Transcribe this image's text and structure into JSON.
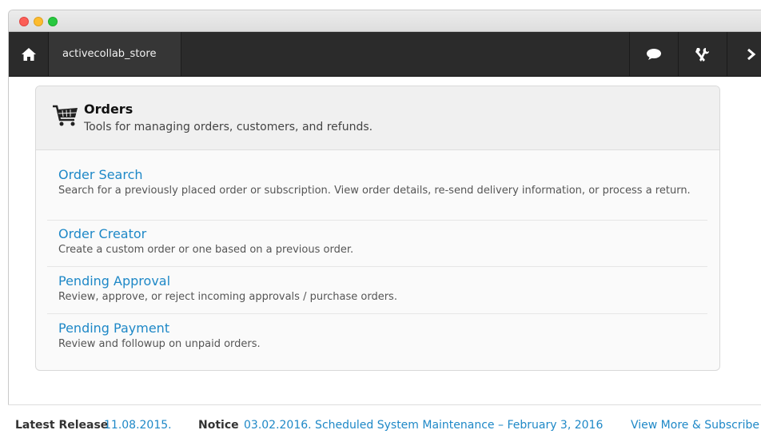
{
  "navbar": {
    "store_name": "activecollab_store"
  },
  "panel": {
    "title": "Orders",
    "subtitle": "Tools for managing orders, customers, and refunds.",
    "items": [
      {
        "title": "Order Search",
        "description": "Search for a previously placed order or subscription. View order details, re-send delivery information, or process a return."
      },
      {
        "title": "Order Creator",
        "description": "Create a custom order or one based on a previous order."
      },
      {
        "title": "Pending Approval",
        "description": "Review, approve, or reject incoming approvals / purchase orders."
      },
      {
        "title": "Pending Payment",
        "description": "Review and followup on unpaid orders."
      }
    ]
  },
  "footer": {
    "release_label": "Latest Release",
    "release_value": "11.08.2015.",
    "notice_label": "Notice",
    "notice_value": "03.02.2016. Scheduled System Maintenance – February 3, 2016",
    "view_more": "View More & Subscribe"
  },
  "icons": {
    "home": "home-icon",
    "chat": "chat-bubble-icon",
    "tools": "tools-icon",
    "next": "chevron-right-icon",
    "cart": "shopping-cart-icon"
  }
}
